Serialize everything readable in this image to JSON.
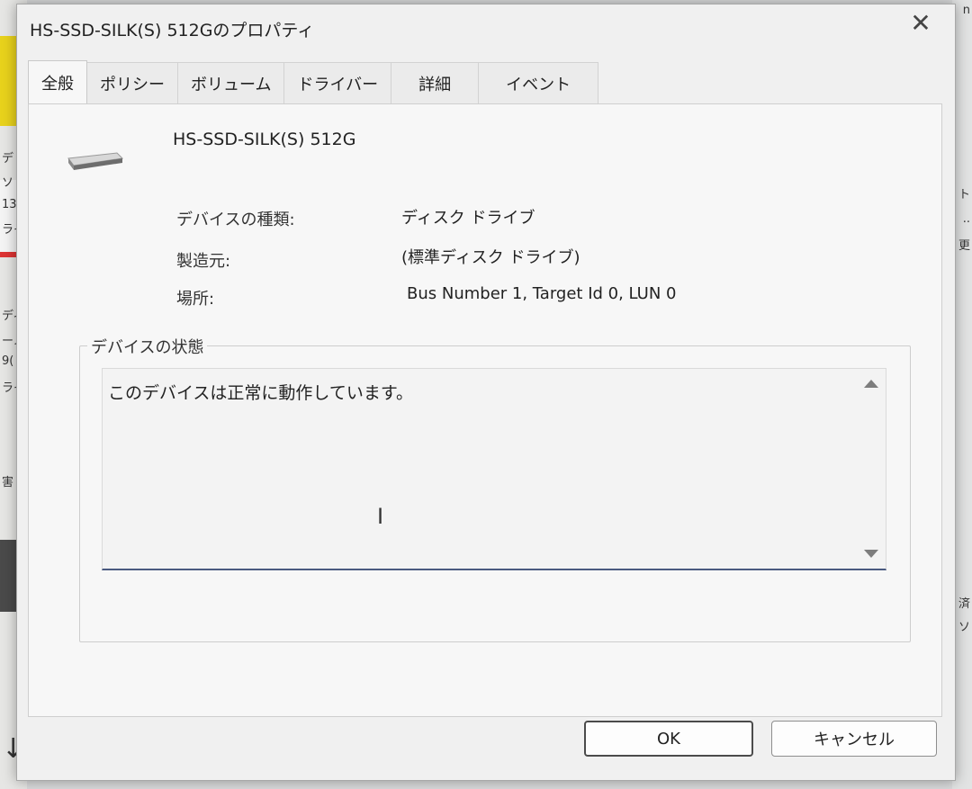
{
  "window": {
    "title": "HS-SSD-SILK(S) 512Gのプロパティ",
    "close_symbol": "✕"
  },
  "tabs": [
    {
      "label": "全般",
      "active": true
    },
    {
      "label": "ポリシー",
      "active": false
    },
    {
      "label": "ボリューム",
      "active": false
    },
    {
      "label": "ドライバー",
      "active": false
    },
    {
      "label": "詳細",
      "active": false
    },
    {
      "label": "イベント",
      "active": false
    }
  ],
  "device": {
    "icon": "drive-icon",
    "name": "HS-SSD-SILK(S) 512G",
    "properties": [
      {
        "label": "デバイスの種類:",
        "value": "ディスク ドライブ"
      },
      {
        "label": "製造元:",
        "value": "(標準ディスク ドライブ)"
      },
      {
        "label": "場所:",
        "value": "Bus Number 1, Target Id 0, LUN 0"
      }
    ]
  },
  "status_group": {
    "title": "デバイスの状態",
    "text": "このデバイスは正常に動作しています。"
  },
  "buttons": {
    "ok_label": "OK",
    "cancel_label": "キャンセル"
  },
  "background": {
    "left_fragments": [
      "デ",
      "ソ",
      "13",
      "ライ",
      "ディ",
      "ーノ",
      "9(",
      "ライ",
      "害"
    ],
    "right_fragments": [
      "n",
      "ト",
      "..",
      "更",
      "済",
      "ソ"
    ],
    "arrow_symbol": "↓"
  }
}
